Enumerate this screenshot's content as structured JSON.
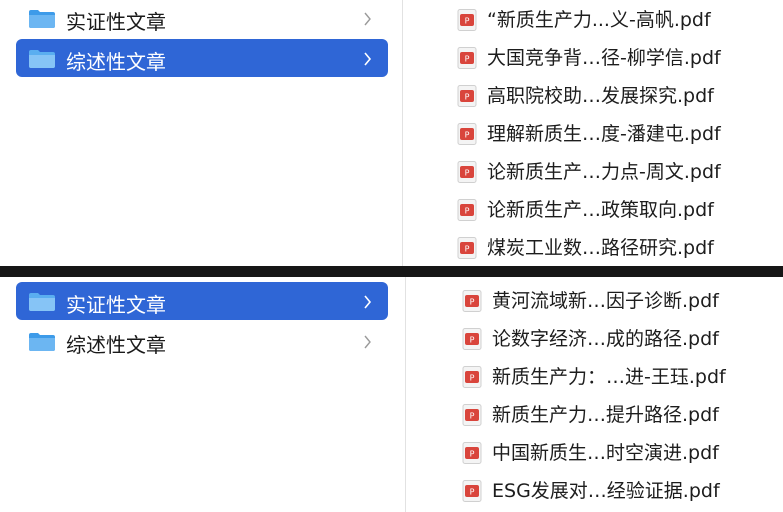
{
  "top_panel": {
    "folders": [
      {
        "label": "实证性文章",
        "selected": false
      },
      {
        "label": "综述性文章",
        "selected": true
      }
    ],
    "files": [
      "“新质生产力...义-高帆.pdf",
      "大国竞争背…径-柳学信.pdf",
      "高职院校助…发展探究.pdf",
      "理解新质生…度-潘建屯.pdf",
      "论新质生产…力点-周文.pdf",
      "论新质生产…政策取向.pdf",
      "煤炭工业数…路径研究.pdf"
    ]
  },
  "bottom_panel": {
    "folders": [
      {
        "label": "实证性文章",
        "selected": true
      },
      {
        "label": "综述性文章",
        "selected": false
      }
    ],
    "files": [
      "黄河流域新…因子诊断.pdf",
      "论数字经济…成的路径.pdf",
      "新质生产力：…进-王珏.pdf",
      "新质生产力…提升路径.pdf",
      "中国新质生…时空演进.pdf",
      "ESG发展对…经验证据.pdf"
    ]
  },
  "colors": {
    "selection": "#2f66d6",
    "folder_icon": "#3d9be9",
    "pdf_icon": "#d9453c",
    "separator": "#161616"
  },
  "icons": {
    "folder": "folder-icon",
    "pdf": "pdf-file-icon",
    "chevron": "chevron-right-icon"
  }
}
